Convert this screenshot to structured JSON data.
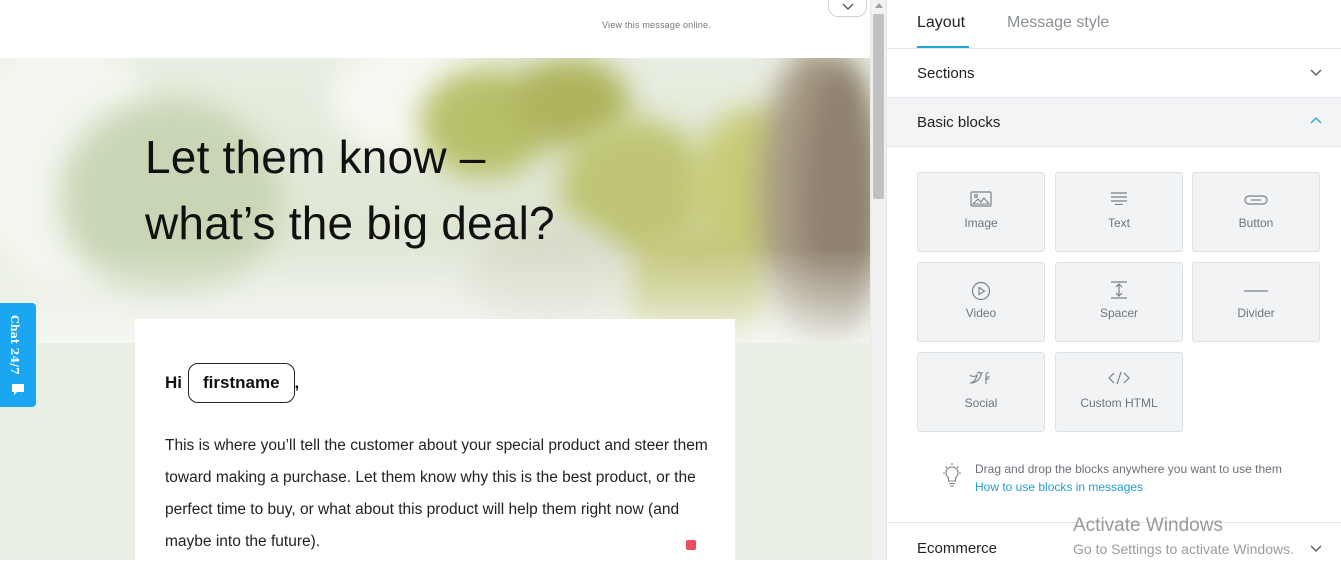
{
  "email": {
    "view_online": "View this message online.",
    "hero_title_line1": "Let them know –",
    "hero_title_line2": "what’s the big deal?",
    "greeting_prefix": "Hi",
    "merge_tag": "firstname",
    "greeting_suffix": ",",
    "body_text": "This is where you’ll tell the customer about your special product and steer them toward making a purchase. Let them know why this is the best product, or the perfect time to buy, or what about this product will help them right now (and maybe into the future)."
  },
  "chat_widget": {
    "label": "Chat 24/7",
    "icon": "chat-bubble-icon"
  },
  "panel": {
    "tabs": [
      {
        "label": "Layout",
        "active": true
      },
      {
        "label": "Message style",
        "active": false
      }
    ],
    "sections": [
      {
        "label": "Sections",
        "expanded": false
      },
      {
        "label": "Basic blocks",
        "expanded": true
      },
      {
        "label": "Ecommerce",
        "expanded": false
      }
    ],
    "blocks": [
      {
        "label": "Image",
        "icon": "image-icon"
      },
      {
        "label": "Text",
        "icon": "text-icon"
      },
      {
        "label": "Button",
        "icon": "button-icon"
      },
      {
        "label": "Video",
        "icon": "video-icon"
      },
      {
        "label": "Spacer",
        "icon": "spacer-icon"
      },
      {
        "label": "Divider",
        "icon": "divider-icon"
      },
      {
        "label": "Social",
        "icon": "social-icon"
      },
      {
        "label": "Custom HTML",
        "icon": "code-icon"
      }
    ],
    "hint_text": "Drag and drop the blocks anywhere you want to use them",
    "hint_link": "How to use blocks in messages"
  },
  "watermark": {
    "title": "Activate Windows",
    "subtitle": "Go to Settings to activate Windows."
  },
  "colors": {
    "accent": "#1fa6d8",
    "chat": "#1aa6f0",
    "panel_section_bg": "#f2f4f6",
    "email_bg": "#e9efe4"
  }
}
